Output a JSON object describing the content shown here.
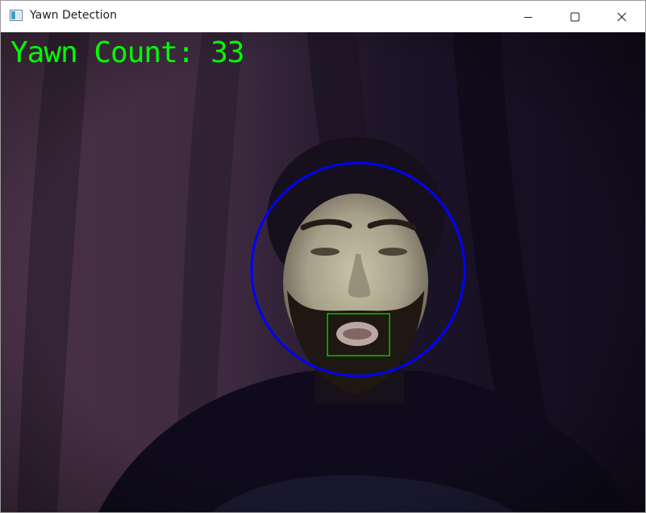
{
  "window": {
    "title": "Yawn Detection",
    "icon": "app-window-icon",
    "controls": [
      "minimize-icon",
      "maximize-icon",
      "close-icon"
    ]
  },
  "overlay": {
    "yawn_count_text": "Yawn Count: 33",
    "text_color": "#00ff00"
  },
  "detections": {
    "face_circle_color": "#0000ff",
    "mouth_box_color": "#00ff00"
  }
}
